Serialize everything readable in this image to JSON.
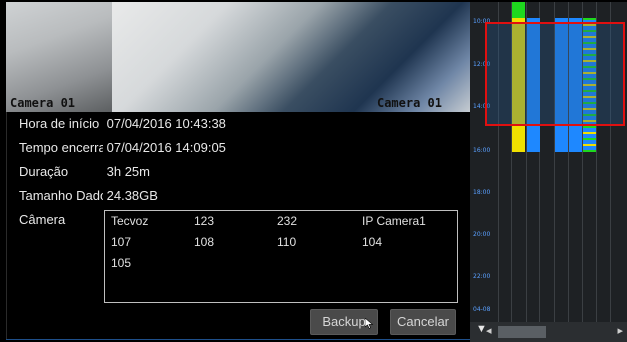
{
  "cameras": {
    "left_label": "Camera 01",
    "right_label": "Camera 01"
  },
  "info": {
    "start_label": "Hora de início",
    "start_value": "07/04/2016 10:43:38",
    "end_label": "Tempo encerramento",
    "end_value": "07/04/2016 14:09:05",
    "duration_label": "Duração",
    "duration_value": "3h 25m",
    "size_label": "Tamanho Dados",
    "size_value": "24.38GB",
    "camera_label": "Câmera"
  },
  "camera_list": [
    [
      "Tecvoz",
      "123",
      "232",
      "IP Camera1"
    ],
    [
      "107",
      "108",
      "110",
      "104"
    ],
    [
      "105",
      "",
      "",
      ""
    ]
  ],
  "buttons": {
    "backup": "Backup",
    "cancel": "Cancelar"
  },
  "timeline": {
    "labels": [
      "10:00",
      "12:00",
      "14:00",
      "16:00",
      "18:00",
      "20:00",
      "22:00",
      "04-08"
    ],
    "accent_green": "#1ed81e",
    "accent_yellow": "#f0e000",
    "accent_blue": "#1e88ff",
    "selection_color": "#e01010"
  },
  "scroll_glyphs": {
    "up": "▼",
    "left": "◂",
    "right": "▸"
  }
}
